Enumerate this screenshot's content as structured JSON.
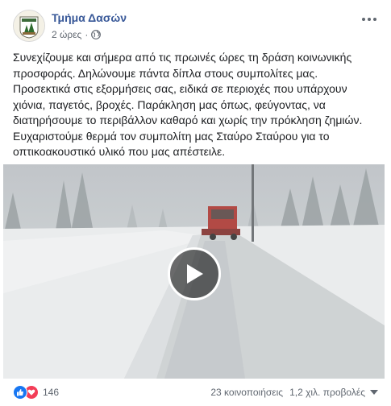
{
  "post": {
    "page_name": "Τμήμα Δασών",
    "time": "2 ώρες",
    "separator": "·",
    "privacy_icon": "globe-icon",
    "text_lines": [
      "Συνεχίζουμε και σήμερα από τις πρωινές ώρες τη δράση κοινωνικής",
      "προσφοράς. Δηλώνουμε πάντα δίπλα στους συμπολίτες μας.",
      "Προσεκτικά στις εξορμήσεις σας, ειδικά σε περιοχές που υπάρχουν",
      "χιόνια, παγετός, βροχές. Παράκληση μας όπως, φεύγοντας, να",
      "διατηρήσουμε το περιβάλλον καθαρό και χωρίς την πρόκληση ζημιών.",
      "Ευχαριστούμε θερμά τον συμπολίτη μας Σταύρο Σταύρου για το",
      "οπτικοακουστικό υλικό που μας απέστειλε."
    ]
  },
  "video": {
    "description": "snowy road with red snowplow truck",
    "play_icon": "play-icon"
  },
  "footer": {
    "reaction_icons": [
      "like-icon",
      "love-icon"
    ],
    "reaction_count": "146",
    "shares": "23 κοινοποιήσεις",
    "views": "1,2 χιλ. προβολές"
  },
  "colors": {
    "link": "#385898",
    "secondary_text": "#606770",
    "like": "#1877f2",
    "love": "#f33e58"
  }
}
